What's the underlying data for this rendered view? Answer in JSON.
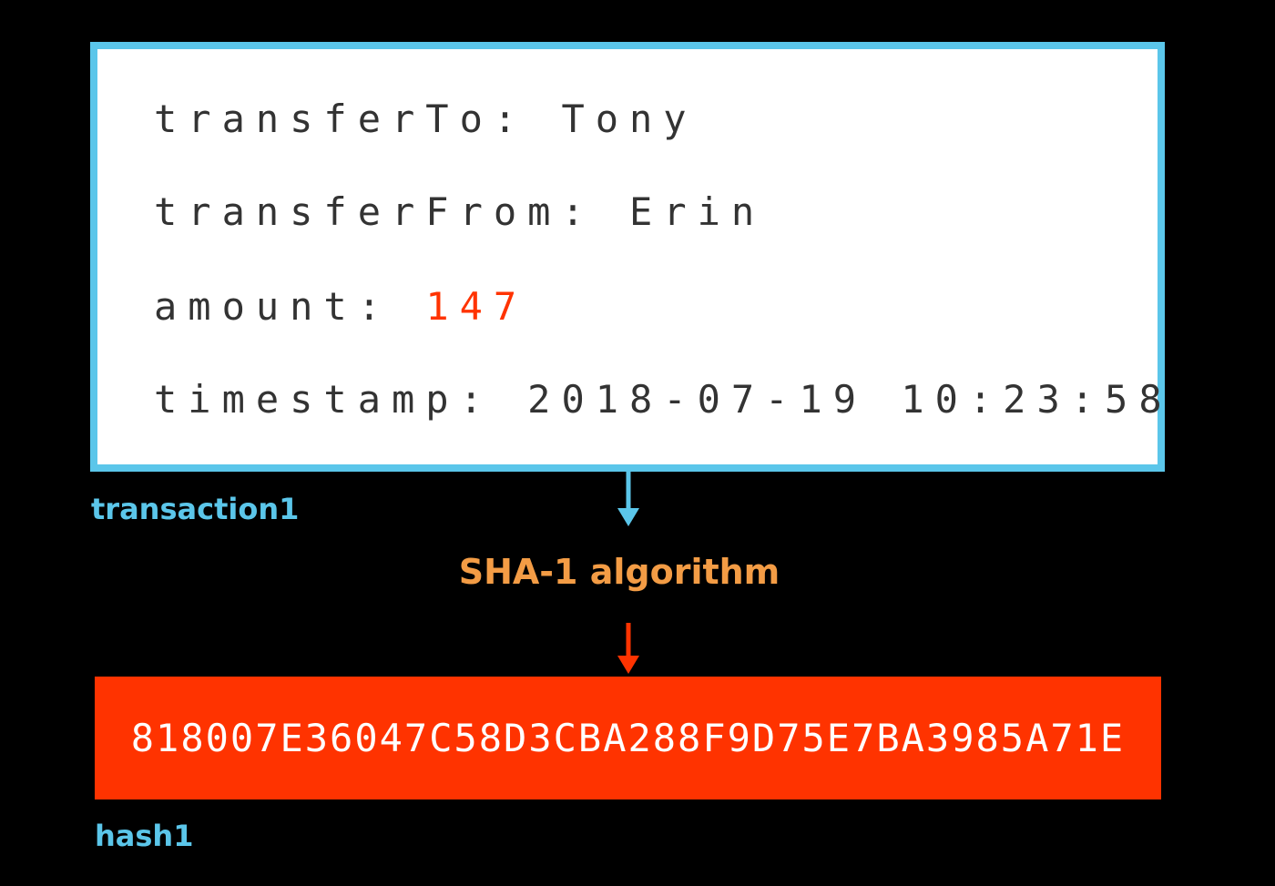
{
  "transaction": {
    "caption": "transaction1",
    "fields": [
      {
        "label": "transferTo:",
        "value": "Tony"
      },
      {
        "label": "transferFrom:",
        "value": "Erin"
      },
      {
        "label": "amount:",
        "value": "147"
      },
      {
        "label": "timestamp:",
        "value": "2018-07-19 10:23:58"
      }
    ]
  },
  "algorithm": {
    "label": "SHA-1 algorithm"
  },
  "hash": {
    "caption": "hash1",
    "value": "818007E36047C58D3CBA288F9D75E7BA3985A71E"
  },
  "colors": {
    "frame": "#5bc6ea",
    "highlight": "#ff3300",
    "algorithm": "#f39c45",
    "hash_bg": "#ff3300",
    "background": "#000000"
  }
}
